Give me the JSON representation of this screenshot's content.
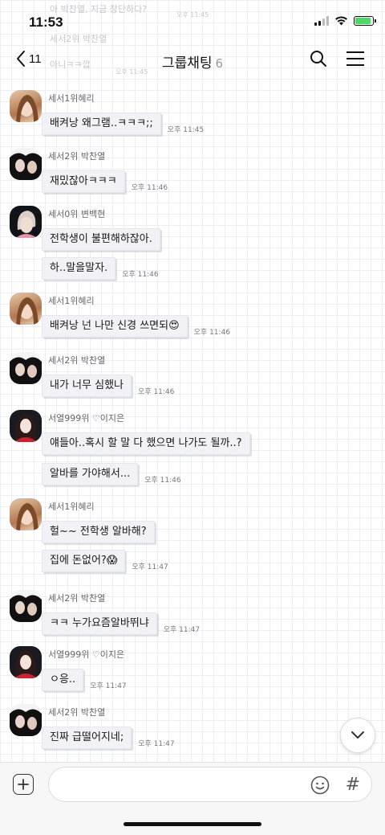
{
  "status_bar": {
    "time": "11:53"
  },
  "ghost_lines": [
    "아 박찬열, 지금 창단하다?",
    "세서2위 박찬열",
    "아니ㅋㅋ깝",
    "오후 11:45",
    "오후 11:45"
  ],
  "header": {
    "back_count": "11",
    "title": "그룹채팅",
    "member_count": "6",
    "icons": [
      "back-chevron-icon",
      "search-icon",
      "menu-icon"
    ]
  },
  "messages": [
    {
      "sender": "세서1위혜리",
      "avatar": "hyeri",
      "bubbles": [
        "배켜낭 왜그램..ㅋㅋㅋ;;"
      ],
      "time": "오후 11:45"
    },
    {
      "sender": "세서2위 박찬열",
      "avatar": "chanyeol",
      "bubbles": [
        "재밌잖아ㅋㅋㅋ"
      ],
      "time": "오후 11:46"
    },
    {
      "sender": "세서0위 변백현",
      "avatar": "baekhyun",
      "bubbles": [
        "전학생이 불편해하잖아.",
        "하..말을말자."
      ],
      "time": "오후 11:46"
    },
    {
      "sender": "세서1위혜리",
      "avatar": "hyeri",
      "bubbles": [
        "배켜낭 넌 나만 신경 쓰면되😍"
      ],
      "time": "오후 11:46"
    },
    {
      "sender": "세서2위 박찬열",
      "avatar": "chanyeol",
      "bubbles": [
        "내가 너무 심했나"
      ],
      "time": "오후 11:46"
    },
    {
      "sender": "서열999위 ♡이지은",
      "avatar": "jieun",
      "bubbles": [
        "얘들아..혹시 할 말 다 했으면 나가도 될까..?",
        "알바를 가야해서..."
      ],
      "time": "오후 11:46"
    },
    {
      "sender": "세서1위혜리",
      "avatar": "hyeri",
      "bubbles": [
        "헐~~ 전학생 알바해?",
        "집에 돈없어?😱"
      ],
      "time": "오후 11:47"
    },
    {
      "sender": "세서2위 박찬열",
      "avatar": "chanyeol",
      "bubbles": [
        "ㅋㅋ 누가요즘알바뛰냐"
      ],
      "time": "오후 11:47"
    },
    {
      "sender": "서열999위 ♡이지은",
      "avatar": "jieun",
      "bubbles": [
        "ㅇ응.."
      ],
      "time": "오후 11:47"
    },
    {
      "sender": "세서2위 박찬열",
      "avatar": "chanyeol",
      "bubbles": [
        "진짜 급떨어지네;"
      ],
      "time": "오후 11:47"
    }
  ],
  "input": {
    "placeholder": "",
    "value": "",
    "icons": [
      "plus-icon",
      "emoji-icon",
      "hashtag-icon"
    ],
    "hash_label": "#"
  },
  "colors": {
    "bubble": "#f1f1f6",
    "grid": "#eceef1",
    "battery": "#4cd964"
  }
}
